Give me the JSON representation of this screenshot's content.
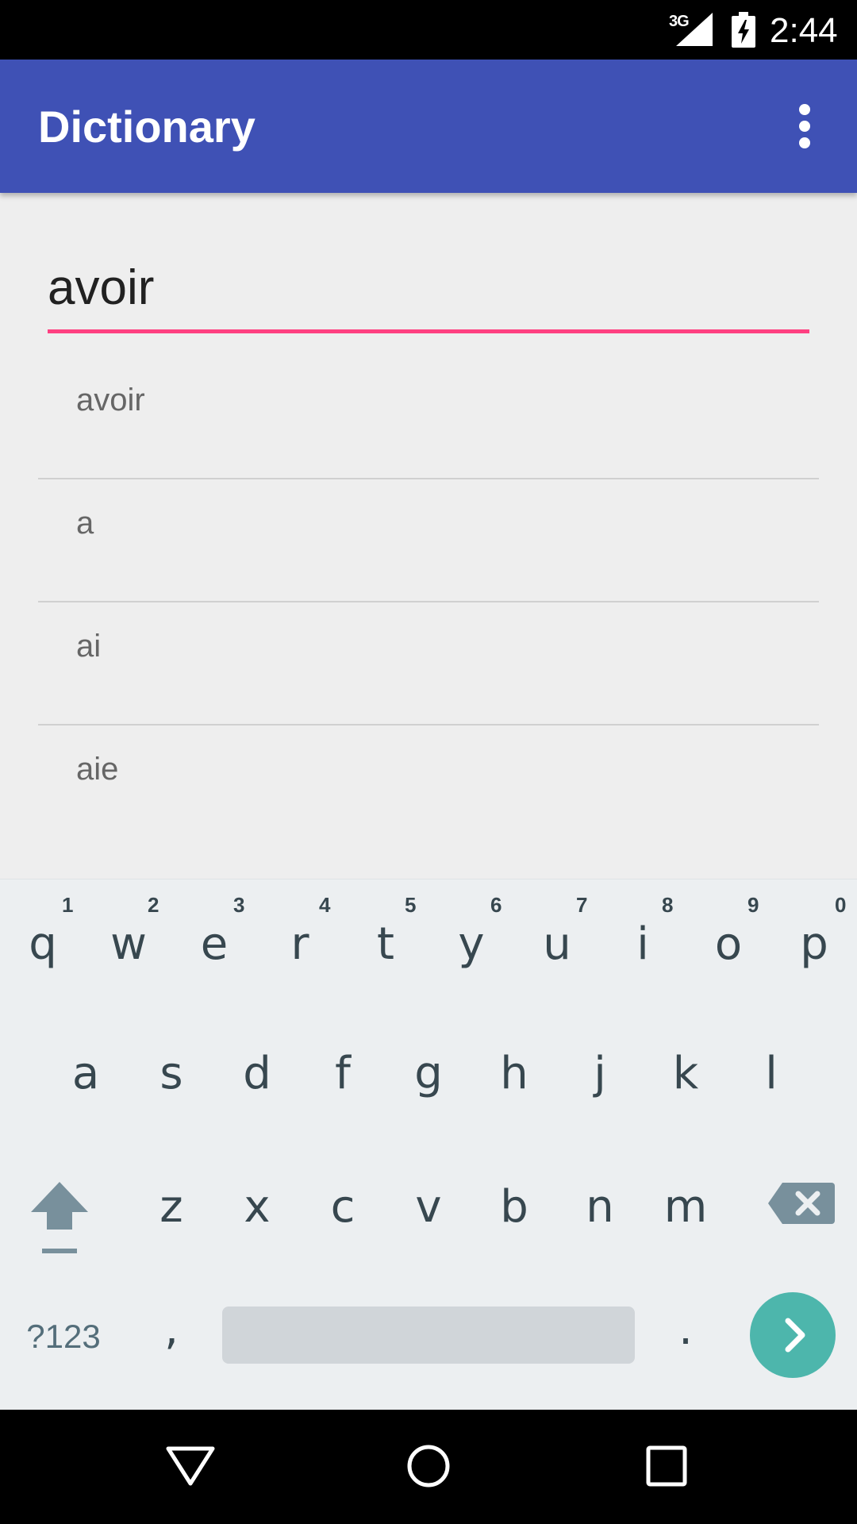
{
  "status_bar": {
    "network": "3G",
    "time": "2:44"
  },
  "app_bar": {
    "title": "Dictionary"
  },
  "search": {
    "value": "avoir",
    "accent_color": "#ff4081"
  },
  "suggestions": [
    {
      "label": "avoir"
    },
    {
      "label": "a"
    },
    {
      "label": "ai"
    },
    {
      "label": "aie"
    }
  ],
  "keyboard": {
    "row1": [
      {
        "letter": "q",
        "hint": "1"
      },
      {
        "letter": "w",
        "hint": "2"
      },
      {
        "letter": "e",
        "hint": "3"
      },
      {
        "letter": "r",
        "hint": "4"
      },
      {
        "letter": "t",
        "hint": "5"
      },
      {
        "letter": "y",
        "hint": "6"
      },
      {
        "letter": "u",
        "hint": "7"
      },
      {
        "letter": "i",
        "hint": "8"
      },
      {
        "letter": "o",
        "hint": "9"
      },
      {
        "letter": "p",
        "hint": "0"
      }
    ],
    "row2": [
      "a",
      "s",
      "d",
      "f",
      "g",
      "h",
      "j",
      "k",
      "l"
    ],
    "row3": [
      "z",
      "x",
      "c",
      "v",
      "b",
      "n",
      "m"
    ],
    "symbols_label": "?123",
    "comma": ",",
    "period": ".",
    "icons": {
      "shift": "shift-icon",
      "backspace": "backspace-icon",
      "go": "chevron-right-icon"
    }
  },
  "nav_bar": {
    "icons": [
      "back-icon",
      "home-icon",
      "recents-icon"
    ]
  },
  "colors": {
    "app_bar": "#3f51b5",
    "content_bg": "#eeeeee",
    "keyboard_bg": "#eceff1",
    "go_key": "#4db6ac"
  }
}
